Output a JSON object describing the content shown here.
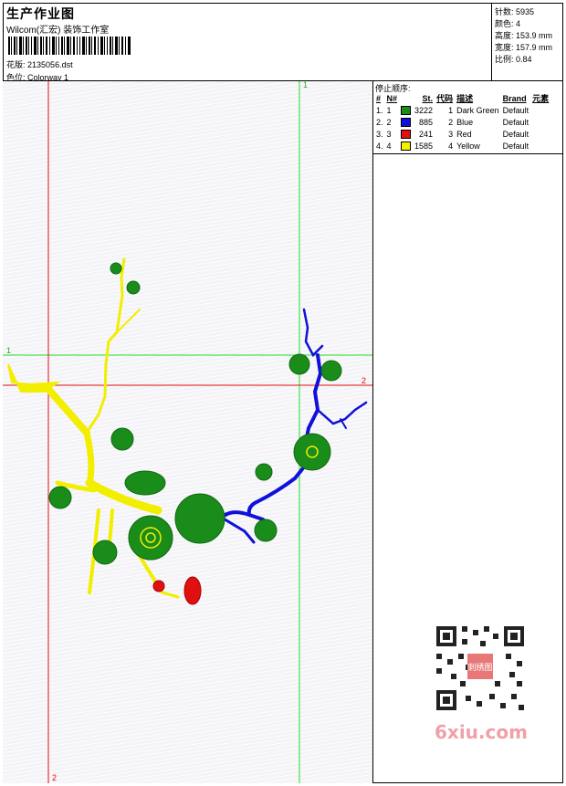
{
  "header": {
    "title": "生产作业图",
    "company": "Wilcom(汇宏) 装饰工作室",
    "design_label": "花版:",
    "design_value": "2135056.dst",
    "colorway_label": "色位:",
    "colorway_value": "Colorway 1"
  },
  "stats": {
    "stitches": "针数: 5935",
    "colors": "颜色: 4",
    "height": "高度: 153.9 mm",
    "width": "宽度: 157.9 mm",
    "ratio": "比例: 0.84"
  },
  "stop_sequence": {
    "label": "停止顺序:",
    "headers": [
      "#",
      "N#",
      "St.",
      "代码",
      "描述",
      "Brand",
      "元素"
    ],
    "rows": [
      {
        "index": "1.",
        "n": "1",
        "color": "#1a8c1a",
        "stitches": "3222",
        "code": "1",
        "desc": "Dark Green",
        "brand": "Default"
      },
      {
        "index": "2.",
        "n": "2",
        "color": "#1010d8",
        "stitches": "885",
        "code": "2",
        "desc": "Blue",
        "brand": "Default"
      },
      {
        "index": "3.",
        "n": "3",
        "color": "#e01010",
        "stitches": "241",
        "code": "3",
        "desc": "Red",
        "brand": "Default"
      },
      {
        "index": "4.",
        "n": "4",
        "color": "#f5f000",
        "stitches": "1585",
        "code": "4",
        "desc": "Yellow",
        "brand": "Default"
      }
    ]
  },
  "guides": {
    "green_v_label": "1",
    "green_h_label": "1",
    "red_h_label": "2",
    "red_v_label": "2"
  },
  "watermark": "6xiu.com",
  "qr_stamp": "刺绣图"
}
